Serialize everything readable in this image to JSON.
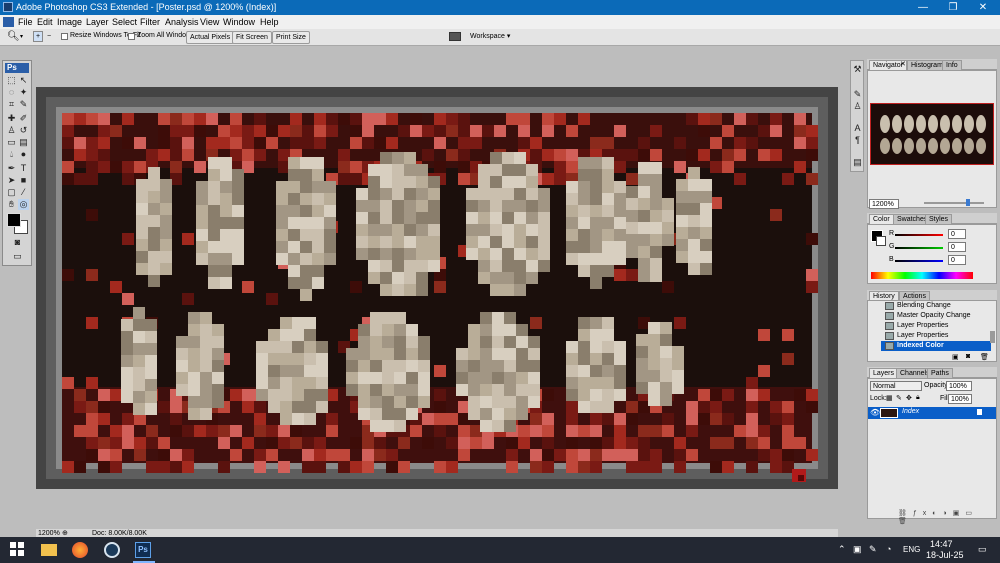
{
  "window": {
    "title": "Adobe Photoshop CS3 Extended - [Poster.psd @ 1200% (Index)]",
    "minimize": "—",
    "restore": "❐",
    "close": "✕"
  },
  "menu": [
    "File",
    "Edit",
    "Image",
    "Layer",
    "Select",
    "Filter",
    "Analysis",
    "View",
    "Window",
    "Help"
  ],
  "options": {
    "resize_windows": "Resize Windows To Fit",
    "zoom_all": "Zoom All Windows",
    "actual_pixels": "Actual Pixels",
    "fit_screen": "Fit Screen",
    "print_size": "Print Size",
    "workspace": "Workspace ▾"
  },
  "tools": {
    "logo": "Ps"
  },
  "status": {
    "zoom": "1200%",
    "doc": "Doc: 8.00K/8.00K"
  },
  "navigator": {
    "tabs": [
      "Navigator",
      "Histogram",
      "Info"
    ],
    "zoom": "1200%"
  },
  "color_panel": {
    "tabs": [
      "Color",
      "Swatches",
      "Styles"
    ],
    "r_label": "R",
    "g_label": "G",
    "b_label": "B",
    "r": "0",
    "g": "0",
    "b": "0"
  },
  "history": {
    "tabs": [
      "History",
      "Actions"
    ],
    "items": [
      "Blending Change",
      "Master Opacity Change",
      "Layer Properties",
      "Layer Properties",
      "Indexed Color"
    ]
  },
  "layers": {
    "tabs": [
      "Layers",
      "Channels",
      "Paths"
    ],
    "blend_mode": "Normal",
    "opacity_label": "Opacity:",
    "opacity": "100%",
    "lock_label": "Lock:",
    "fill_label": "Fill:",
    "fill": "100%",
    "layer_name": "Index"
  },
  "taskbar": {
    "time": "14:47",
    "date": "18-Jul-25",
    "lang": "ENG",
    "ps_label": "Ps"
  },
  "colors": {
    "titlebar": "#0b6ab8",
    "selection": "#0a5ec8",
    "canvas_bg": "#505050"
  }
}
